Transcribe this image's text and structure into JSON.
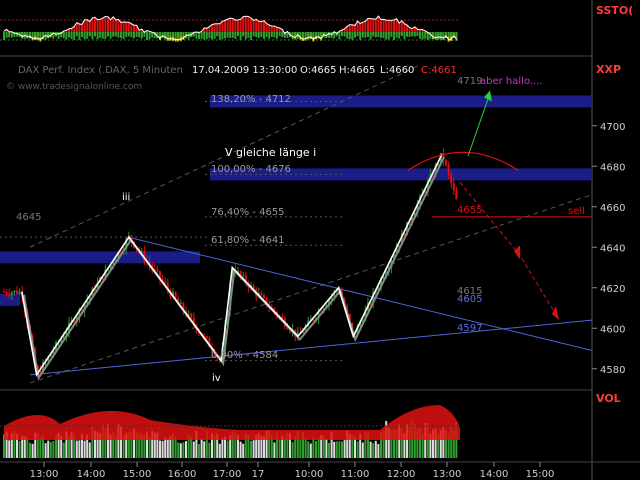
{
  "header": {
    "symbol": "DAX Perf. Index (.DAX, 5 Minuten",
    "date_time": "17.04.2009 13:30:00",
    "open": "O:4665",
    "high": "H:4665",
    "low": "L:4660",
    "close": "C:4661",
    "watermark": "© www.tradesignalonline.com"
  },
  "panels": {
    "ssto": {
      "label": "SSTO("
    },
    "price": {
      "label": "XXP"
    },
    "vol": {
      "label": "VOL"
    }
  },
  "colors": {
    "up": "#2f8f2f",
    "down": "#e01010",
    "wave": "#ffffff",
    "trendline": "#4e63d8",
    "fib_band": "#1a1f8c",
    "annotation_green": "#2ecc40",
    "annotation_red": "#e01010",
    "close_value": "#ff2a2a",
    "magenta": "#cc33cc"
  },
  "chart_data": {
    "type": "candlestick",
    "instrument": "DAX Perf. Index (.DAX)",
    "interval": "5 Minuten",
    "ylim": [
      4570,
      4730
    ],
    "yticks": [
      4580,
      4600,
      4620,
      4640,
      4660,
      4680,
      4700
    ],
    "xticks": [
      "13:00",
      "14:00",
      "15:00",
      "16:00",
      "17:00",
      "17",
      "10:00",
      "11:00",
      "12:00",
      "13:00",
      "14:00",
      "15:00"
    ],
    "wave_points": [
      {
        "time": "12:30",
        "price": 4618
      },
      {
        "time": "12:50",
        "price": 4577
      },
      {
        "time": "14:55",
        "price": 4645
      },
      {
        "time": "17:00",
        "price": 4584
      },
      {
        "time": "17:15",
        "price": 4630
      },
      {
        "time": "09:45",
        "price": 4596
      },
      {
        "time": "10:40",
        "price": 4620
      },
      {
        "time": "11:00",
        "price": 4596
      },
      {
        "time": "12:45",
        "price": 4686
      }
    ],
    "fib_levels": [
      {
        "label": "138,20% - 4712",
        "value": 4712
      },
      {
        "label": "100,00% - 4676",
        "value": 4676
      },
      {
        "label": "76,40% - 4655",
        "value": 4655
      },
      {
        "label": "61,80% - 4641",
        "value": 4641
      },
      {
        "label": "0,00% - 4584",
        "value": 4584
      }
    ],
    "zones": [
      {
        "value": 4712
      },
      {
        "value": 4676
      },
      {
        "value": 4635
      },
      {
        "value": 4614
      }
    ],
    "levels": [
      {
        "label": "4719",
        "value": 4719
      },
      {
        "label": "4655",
        "value": 4655
      },
      {
        "label": "4645",
        "value": 4645
      },
      {
        "label": "4615",
        "value": 4615
      },
      {
        "label": "4605",
        "value": 4605
      },
      {
        "label": "4597",
        "value": 4597
      }
    ],
    "wave_labels": [
      "iii",
      "iv",
      "V gleiche länge i"
    ],
    "annotations": [
      "aber hallo....",
      "sell"
    ],
    "last": {
      "open": 4665,
      "high": 4665,
      "low": 4660,
      "close": 4661
    }
  }
}
